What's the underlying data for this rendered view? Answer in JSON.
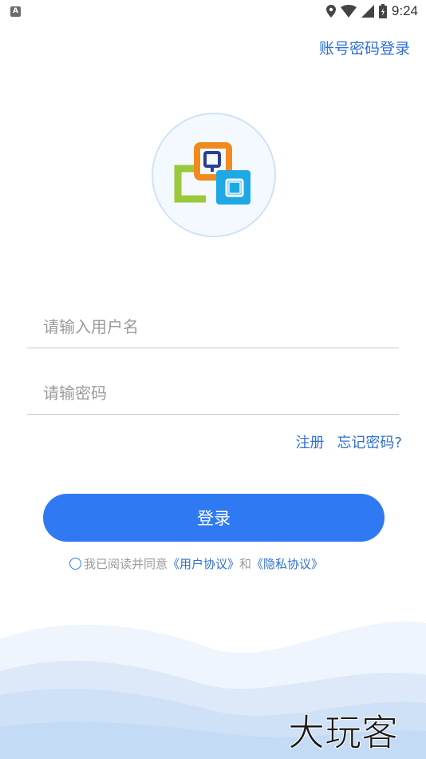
{
  "status_bar": {
    "app_icon_letter": "A",
    "time": "9:24",
    "icons": [
      "location-icon",
      "wifi-icon",
      "cell-signal-icon",
      "battery-icon"
    ]
  },
  "header": {
    "account_login_label": "账号密码登录"
  },
  "logo": {
    "name": "app-logo",
    "colors": {
      "orange": "#f08a1e",
      "green": "#9ac93c",
      "blue": "#1ea8e6",
      "navy": "#2a3f8f"
    }
  },
  "form": {
    "username_placeholder": "请输入用户名",
    "password_placeholder": "请输密码",
    "register_label": "注册",
    "forgot_label": "忘记密码?",
    "login_label": "登录"
  },
  "agreement": {
    "prefix": "我已阅读并同意",
    "user_agreement": "《用户协议》",
    "and": "和",
    "privacy_policy": "《隐私协议》"
  },
  "watermark": {
    "text": "大玩客"
  },
  "colors": {
    "accent": "#2f7af2",
    "link": "#2f6fd6",
    "wave_light": "#e8f1fc",
    "wave_dark": "#c3dbf5"
  }
}
